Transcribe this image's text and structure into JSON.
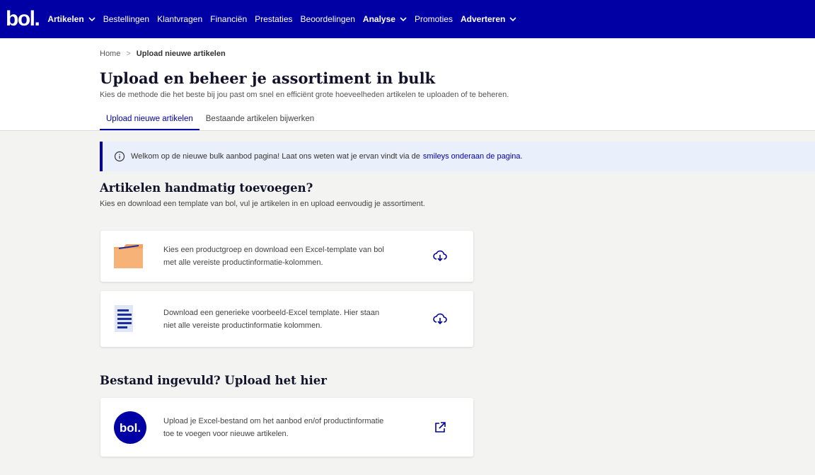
{
  "nav": {
    "logo": "bol.",
    "items": [
      {
        "label": "Artikelen",
        "bold": true,
        "dropdown": true
      },
      {
        "label": "Bestellingen",
        "bold": false,
        "dropdown": false
      },
      {
        "label": "Klantvragen",
        "bold": false,
        "dropdown": false
      },
      {
        "label": "Financiën",
        "bold": false,
        "dropdown": false
      },
      {
        "label": "Prestaties",
        "bold": false,
        "dropdown": false
      },
      {
        "label": "Beoordelingen",
        "bold": false,
        "dropdown": false
      },
      {
        "label": "Analyse",
        "bold": true,
        "dropdown": true
      },
      {
        "label": "Promoties",
        "bold": false,
        "dropdown": false
      },
      {
        "label": "Adverteren",
        "bold": true,
        "dropdown": true
      }
    ]
  },
  "breadcrumb": {
    "home": "Home",
    "separator": ">",
    "current": "Upload nieuwe artikelen"
  },
  "header": {
    "title": "Upload en beheer je assortiment in bulk",
    "subtitle": "Kies de methode die het beste bij jou past om snel en efficiënt grote hoeveelheden artikelen te uploaden of te beheren."
  },
  "tabs": [
    {
      "label": "Upload nieuwe artikelen",
      "active": true
    },
    {
      "label": "Bestaande artikelen bijwerken",
      "active": false
    }
  ],
  "banner": {
    "icon": "info-icon",
    "text": "Welkom op de nieuwe bulk aanbod pagina! Laat ons weten wat je ervan vindt via de",
    "link": "smileys onderaan de pagina",
    "suffix": "."
  },
  "manual": {
    "title": "Artikelen handmatig toevoegen?",
    "subtitle": "Kies en download een template van bol, vul je artikelen in en upload eenvoudig je assortiment.",
    "cards": [
      {
        "icon": "folder-icon",
        "line1": "Kies een productgroep en download een Excel-template van bol",
        "line2": "met alle vereiste productinformatie-kolommen.",
        "action_icon": "cloud-download-icon"
      },
      {
        "icon": "document-icon",
        "line1": "Download een generieke voorbeeld-Excel template. Hier staan",
        "line2": "niet alle vereiste productinformatie kolommen.",
        "action_icon": "cloud-download-icon"
      }
    ]
  },
  "upload": {
    "title": "Bestand ingevuld? Upload het hier",
    "card": {
      "logo": "bol.",
      "line1": "Upload je Excel-bestand om het aanbod en/of productinformatie",
      "line2": "toe te voegen voor nieuwe artikelen.",
      "action_icon": "external-link-icon"
    }
  },
  "colors": {
    "brand": "#0000a4",
    "background": "#f3f3f1",
    "banner": "#eaf0fb",
    "folder": "#f4a261"
  }
}
